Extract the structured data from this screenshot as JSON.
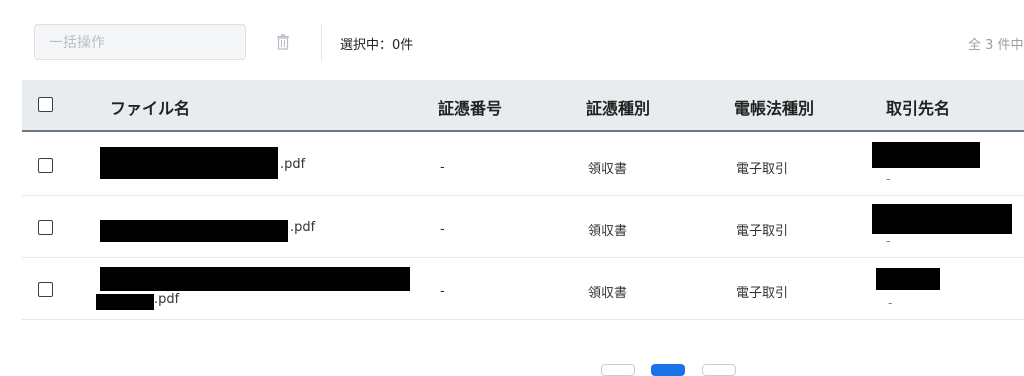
{
  "toolbar": {
    "bulk_action_placeholder": "一括操作",
    "selected_label": "選択中：0件",
    "total_label": "全 3 件中"
  },
  "table": {
    "columns": [
      "ファイル名",
      "証憑番号",
      "証憑種別",
      "電帳法種別",
      "取引先名"
    ],
    "rows": [
      {
        "file_suffix": ".pdf",
        "voucher_no": "-",
        "voucher_type": "領収書",
        "ebook_type": "電子取引",
        "partner_sub": "-"
      },
      {
        "file_suffix": ".pdf",
        "voucher_no": "-",
        "voucher_type": "領収書",
        "ebook_type": "電子取引",
        "partner_sub": "-"
      },
      {
        "file_suffix": ".pdf",
        "voucher_no": "-",
        "voucher_type": "領収書",
        "ebook_type": "電子取引",
        "partner_sub": "-"
      }
    ]
  },
  "icons": {
    "delete": "trash-icon"
  },
  "colors": {
    "header_bg": "#e9ecef",
    "pager_active": "#1a73e8"
  }
}
